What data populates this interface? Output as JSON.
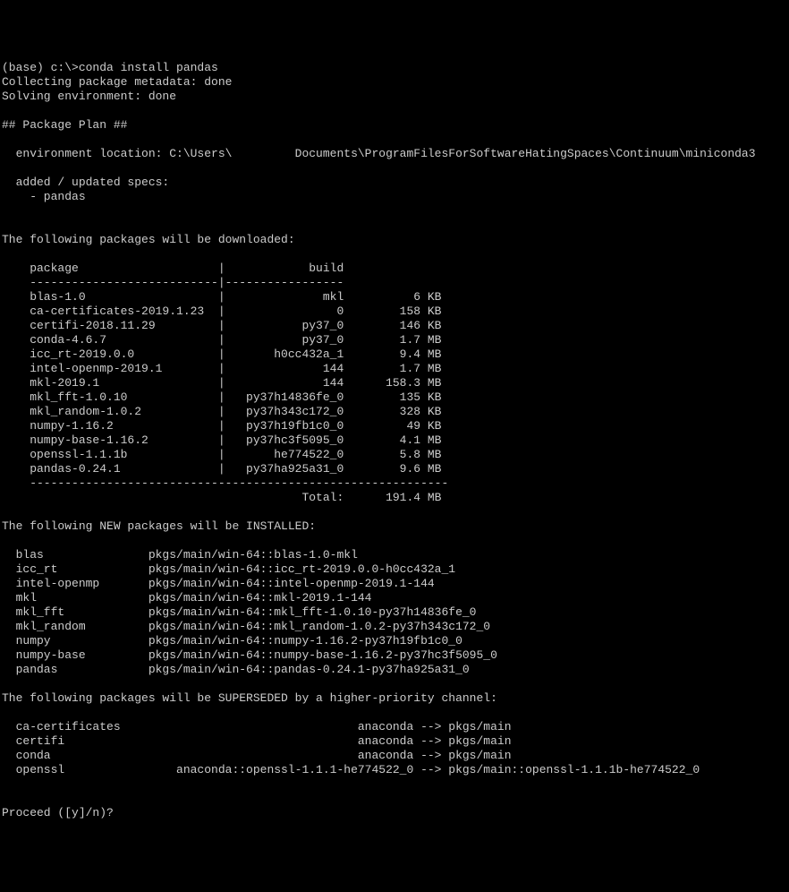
{
  "prompt_line": "(base) c:\\>conda install pandas",
  "collecting": "Collecting package metadata: done",
  "solving": "Solving environment: done",
  "plan_header": "## Package Plan ##",
  "env_location": "  environment location: C:\\Users\\         Documents\\ProgramFilesForSoftwareHatingSpaces\\Continuum\\miniconda3",
  "specs_header": "  added / updated specs:",
  "specs_item": "    - pandas",
  "download_header": "The following packages will be downloaded:",
  "table_header_package": "    package",
  "table_header_build": "build",
  "table_divider_top": "    ---------------------------|-----------------",
  "downloads": [
    {
      "name": "blas-1.0",
      "build": "mkl",
      "size": "6 KB"
    },
    {
      "name": "ca-certificates-2019.1.23",
      "build": "0",
      "size": "158 KB"
    },
    {
      "name": "certifi-2018.11.29",
      "build": "py37_0",
      "size": "146 KB"
    },
    {
      "name": "conda-4.6.7",
      "build": "py37_0",
      "size": "1.7 MB"
    },
    {
      "name": "icc_rt-2019.0.0",
      "build": "h0cc432a_1",
      "size": "9.4 MB"
    },
    {
      "name": "intel-openmp-2019.1",
      "build": "144",
      "size": "1.7 MB"
    },
    {
      "name": "mkl-2019.1",
      "build": "144",
      "size": "158.3 MB"
    },
    {
      "name": "mkl_fft-1.0.10",
      "build": "py37h14836fe_0",
      "size": "135 KB"
    },
    {
      "name": "mkl_random-1.0.2",
      "build": "py37h343c172_0",
      "size": "328 KB"
    },
    {
      "name": "numpy-1.16.2",
      "build": "py37h19fb1c0_0",
      "size": "49 KB"
    },
    {
      "name": "numpy-base-1.16.2",
      "build": "py37hc3f5095_0",
      "size": "4.1 MB"
    },
    {
      "name": "openssl-1.1.1b",
      "build": "he774522_0",
      "size": "5.8 MB"
    },
    {
      "name": "pandas-0.24.1",
      "build": "py37ha925a31_0",
      "size": "9.6 MB"
    }
  ],
  "table_divider_bottom": "    ------------------------------------------------------------",
  "total_label": "Total:",
  "total_value": "191.4 MB",
  "install_header": "The following NEW packages will be INSTALLED:",
  "installs": [
    {
      "name": "blas",
      "spec": "pkgs/main/win-64::blas-1.0-mkl"
    },
    {
      "name": "icc_rt",
      "spec": "pkgs/main/win-64::icc_rt-2019.0.0-h0cc432a_1"
    },
    {
      "name": "intel-openmp",
      "spec": "pkgs/main/win-64::intel-openmp-2019.1-144"
    },
    {
      "name": "mkl",
      "spec": "pkgs/main/win-64::mkl-2019.1-144"
    },
    {
      "name": "mkl_fft",
      "spec": "pkgs/main/win-64::mkl_fft-1.0.10-py37h14836fe_0"
    },
    {
      "name": "mkl_random",
      "spec": "pkgs/main/win-64::mkl_random-1.0.2-py37h343c172_0"
    },
    {
      "name": "numpy",
      "spec": "pkgs/main/win-64::numpy-1.16.2-py37h19fb1c0_0"
    },
    {
      "name": "numpy-base",
      "spec": "pkgs/main/win-64::numpy-base-1.16.2-py37hc3f5095_0"
    },
    {
      "name": "pandas",
      "spec": "pkgs/main/win-64::pandas-0.24.1-py37ha925a31_0"
    }
  ],
  "supersede_header": "The following packages will be SUPERSEDED by a higher-priority channel:",
  "supersedes": [
    {
      "name": "ca-certificates",
      "from": "anaconda",
      "to": "pkgs/main"
    },
    {
      "name": "certifi",
      "from": "anaconda",
      "to": "pkgs/main"
    },
    {
      "name": "conda",
      "from": "anaconda",
      "to": "pkgs/main"
    },
    {
      "name": "openssl",
      "from": "anaconda::openssl-1.1.1-he774522_0",
      "to": "pkgs/main::openssl-1.1.1b-he774522_0"
    }
  ],
  "proceed_prompt": "Proceed ([y]/n)?"
}
